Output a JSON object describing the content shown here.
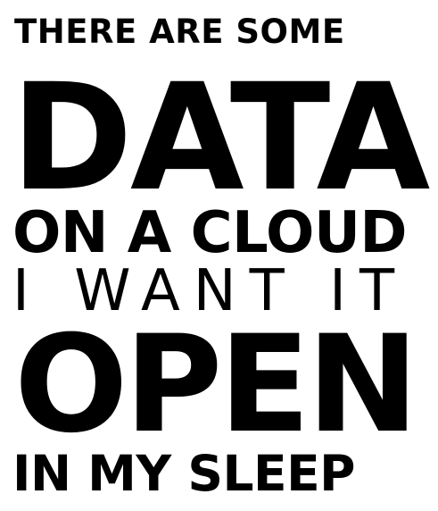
{
  "poster": {
    "lines": [
      "THERE ARE SOME",
      "DATA",
      "ON A CLOUD",
      "I WANT IT",
      "OPEN",
      "IN MY SLEEP"
    ]
  },
  "colors": {
    "text": "#000000",
    "background": "#ffffff"
  }
}
